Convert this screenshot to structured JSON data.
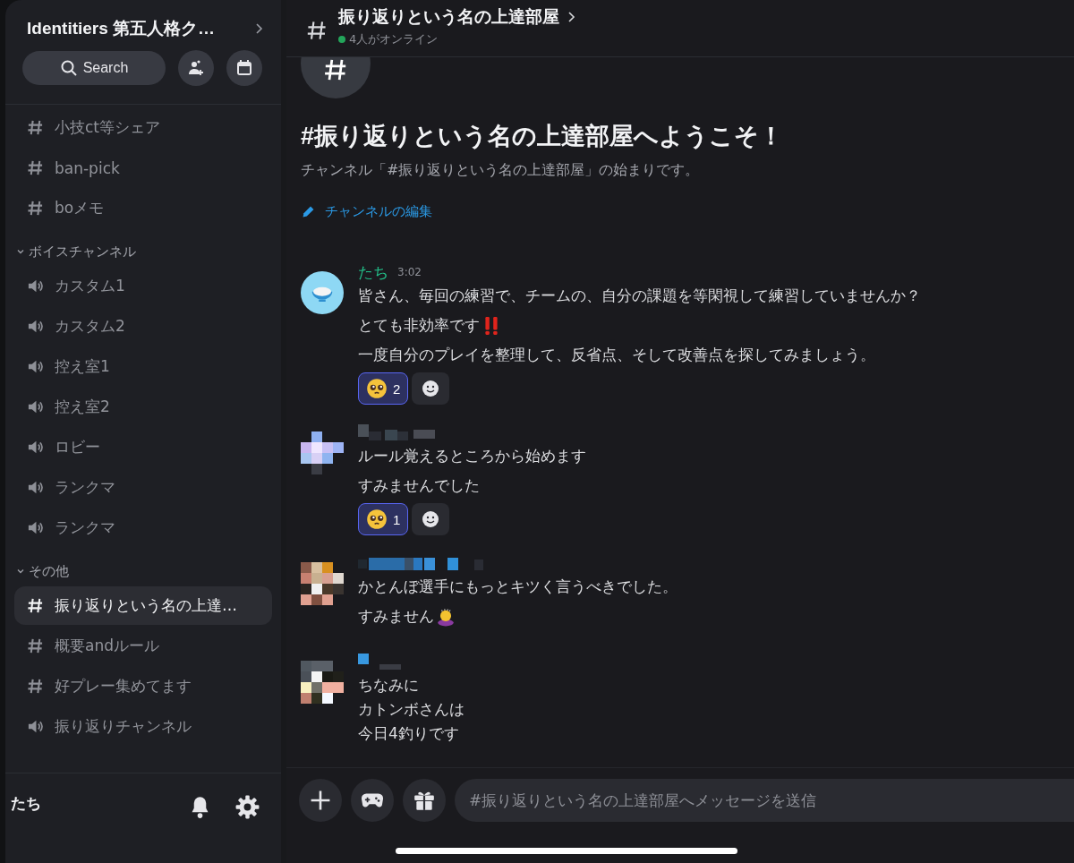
{
  "server": {
    "name": "Identitiers 第五人格ク…"
  },
  "search": {
    "label": "Search"
  },
  "sidebar": {
    "items": [
      {
        "kind": "text",
        "label": "小技ct等シェア",
        "selected": false
      },
      {
        "kind": "text",
        "label": "ban-pick",
        "selected": false
      },
      {
        "kind": "text",
        "label": "boメモ",
        "selected": false
      },
      {
        "kind": "category",
        "label": "ボイスチャンネル",
        "expanded": true
      },
      {
        "kind": "voice",
        "label": "カスタム1",
        "selected": false
      },
      {
        "kind": "voice",
        "label": "カスタム2",
        "selected": false
      },
      {
        "kind": "voice",
        "label": "控え室1",
        "selected": false
      },
      {
        "kind": "voice",
        "label": "控え室2",
        "selected": false
      },
      {
        "kind": "voice",
        "label": "ロビー",
        "selected": false
      },
      {
        "kind": "voice",
        "label": "ランクマ",
        "selected": false
      },
      {
        "kind": "voice",
        "label": "ランクマ",
        "selected": false
      },
      {
        "kind": "category",
        "label": "その他",
        "expanded": true
      },
      {
        "kind": "text",
        "label": "振り返りという名の上達…",
        "selected": true
      },
      {
        "kind": "text",
        "label": "概要andルール",
        "selected": false
      },
      {
        "kind": "text",
        "label": "好プレー集めてます",
        "selected": false
      },
      {
        "kind": "voice",
        "label": "振り返りチャンネル",
        "selected": false
      }
    ]
  },
  "user": {
    "name": "たち"
  },
  "header": {
    "title": "振り返りという名の上達部屋",
    "online": "4人がオンライン"
  },
  "welcome": {
    "title": "#振り返りという名の上達部屋へようこそ！",
    "subtitle": "チャンネル「#振り返りという名の上達部屋」の始まりです。",
    "edit_link": "チャンネルの編集"
  },
  "messages": [
    {
      "kind": "named",
      "author": "たち",
      "time": "3:02",
      "avatar": {
        "kind": "bowl"
      },
      "paragraphs": [
        {
          "lines": [
            "皆さん、毎回の練習で、チームの、自分の課題を等閑視して練習していませんか？"
          ]
        },
        {
          "lines": [
            "とても非効率です"
          ],
          "emoji": {
            "kind": "double-exclamation"
          }
        },
        {
          "lines": [
            "一度自分のプレイを整理して、反省点、そして改善点を探してみましょう。"
          ]
        }
      ],
      "reactions": [
        {
          "count": "2",
          "selected": true
        }
      ]
    },
    {
      "kind": "obscured",
      "avatar": {
        "kind": "pixelated"
      },
      "paragraphs": [
        {
          "lines": [
            "ルール覚えるところから始めます"
          ]
        },
        {
          "lines": [
            "すみませんでした"
          ]
        }
      ],
      "reactions": [
        {
          "count": "1",
          "selected": true
        }
      ]
    },
    {
      "kind": "obscured",
      "avatar": {
        "kind": "pixelated"
      },
      "paragraphs": [
        {
          "lines": [
            "かとんぼ選手にもっとキツく言うべきでした。"
          ]
        },
        {
          "lines": [
            "すみません"
          ],
          "emoji": {
            "kind": "bowing"
          }
        }
      ]
    },
    {
      "kind": "obscured",
      "avatar": {
        "kind": "pixelated"
      },
      "paragraphs": [
        {
          "lines": [
            "ちなみに",
            "カトンボさんは",
            "今日4釣りです"
          ]
        }
      ]
    }
  ],
  "composer": {
    "placeholder": "#振り返りという名の上達部屋へメッセージを送信"
  }
}
